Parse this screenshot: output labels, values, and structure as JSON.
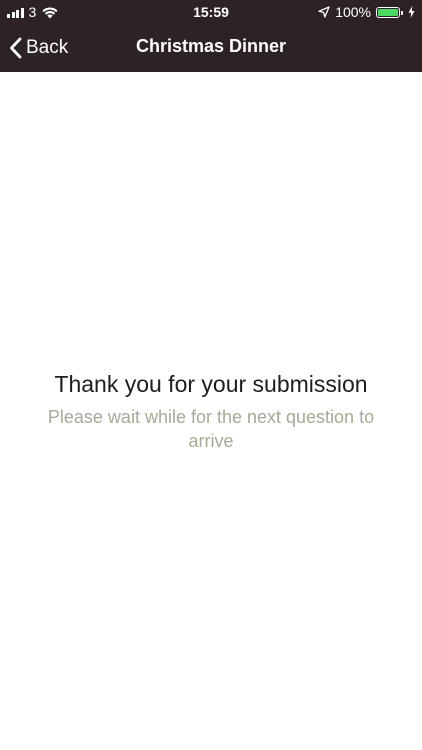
{
  "status_bar": {
    "carrier": "3",
    "time": "15:59",
    "battery_percent": "100%",
    "battery_level": 1.0,
    "icons": [
      "signal-icon",
      "wifi-icon",
      "location-icon",
      "battery-icon",
      "charging-icon"
    ]
  },
  "nav": {
    "back_label": "Back",
    "title": "Christmas Dinner"
  },
  "main": {
    "headline": "Thank you for your submission",
    "subline": "Please wait while for the next question to arrive"
  },
  "colors": {
    "navbar_bg": "#2d2326",
    "headline": "#1e1e1e",
    "subline": "#aaa894",
    "battery_fill": "#4cd964"
  }
}
